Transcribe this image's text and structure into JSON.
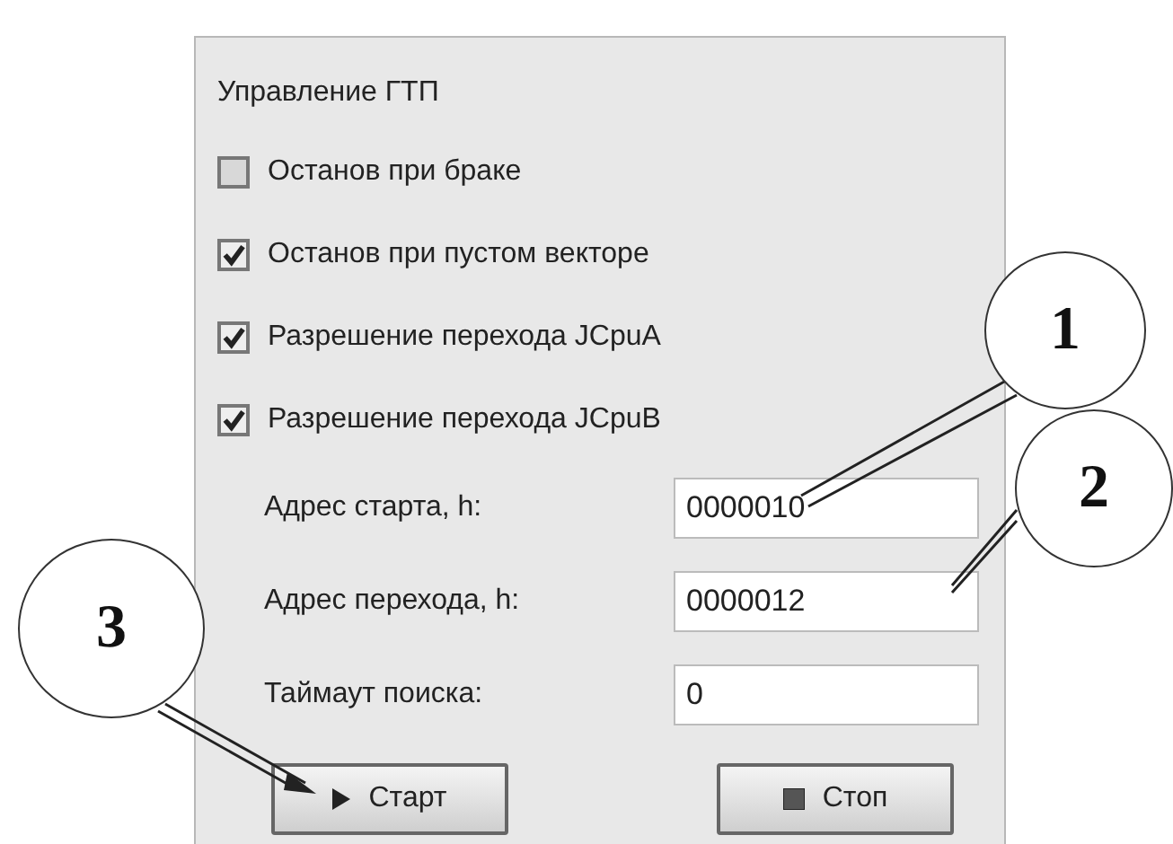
{
  "group": {
    "title": "Управление ГТП"
  },
  "checkboxes": [
    {
      "label": "Останов при браке",
      "checked": false
    },
    {
      "label": "Останов при пустом векторе",
      "checked": true
    },
    {
      "label": "Разрешение перехода JCpuA",
      "checked": true
    },
    {
      "label": "Разрешение перехода JCpuB",
      "checked": true
    }
  ],
  "fields": [
    {
      "label": "Адрес старта, h:",
      "value": "0000010"
    },
    {
      "label": "Адрес перехода, h:",
      "value": "0000012"
    },
    {
      "label": "Таймаут поиска:",
      "value": "0"
    }
  ],
  "buttons": [
    {
      "label": "Старт",
      "kind": "start"
    },
    {
      "label": "Стоп",
      "kind": "stop"
    }
  ],
  "callouts": [
    {
      "label": "1"
    },
    {
      "label": "2"
    },
    {
      "label": "3"
    }
  ]
}
